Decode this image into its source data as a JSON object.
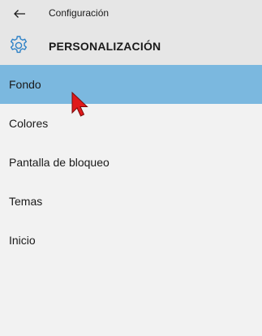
{
  "window": {
    "title": "Configuración"
  },
  "header": {
    "title": "PERSONALIZACIÓN",
    "icon": "gear-icon",
    "accent": "#2e82c7"
  },
  "nav": {
    "selected_color": "#7bb8df",
    "items": [
      {
        "label": "Fondo",
        "selected": true
      },
      {
        "label": "Colores",
        "selected": false
      },
      {
        "label": "Pantalla de bloqueo",
        "selected": false
      },
      {
        "label": "Temas",
        "selected": false
      },
      {
        "label": "Inicio",
        "selected": false
      }
    ]
  },
  "cursor": {
    "icon": "mouse-pointer-icon",
    "color": "#e0191b"
  }
}
